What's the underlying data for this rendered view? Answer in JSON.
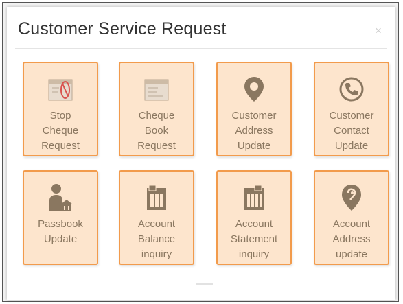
{
  "dialog": {
    "title": "Customer Service Request",
    "close_symbol": "×"
  },
  "tiles": [
    {
      "label": "Stop\nCheque\nRequest",
      "icon": "stop-cheque-icon"
    },
    {
      "label": "Cheque\nBook\nRequest",
      "icon": "cheque-book-icon"
    },
    {
      "label": "Customer\nAddress\nUpdate",
      "icon": "location-pin-icon"
    },
    {
      "label": "Customer\nContact\nUpdate",
      "icon": "phone-icon"
    },
    {
      "label": "Passbook\nUpdate",
      "icon": "passbook-user-icon"
    },
    {
      "label": "Account\nBalance\ninquiry",
      "icon": "account-balance-icon"
    },
    {
      "label": "Account\nStatement\ninquiry",
      "icon": "account-statement-icon"
    },
    {
      "label": "Account\nAddress\nupdate",
      "icon": "address-pin-icon"
    }
  ],
  "colors": {
    "tile_background": "#fde5cd",
    "tile_border": "#f29b4c",
    "icon_fill": "#8a7760",
    "label_text": "#8a7760"
  }
}
